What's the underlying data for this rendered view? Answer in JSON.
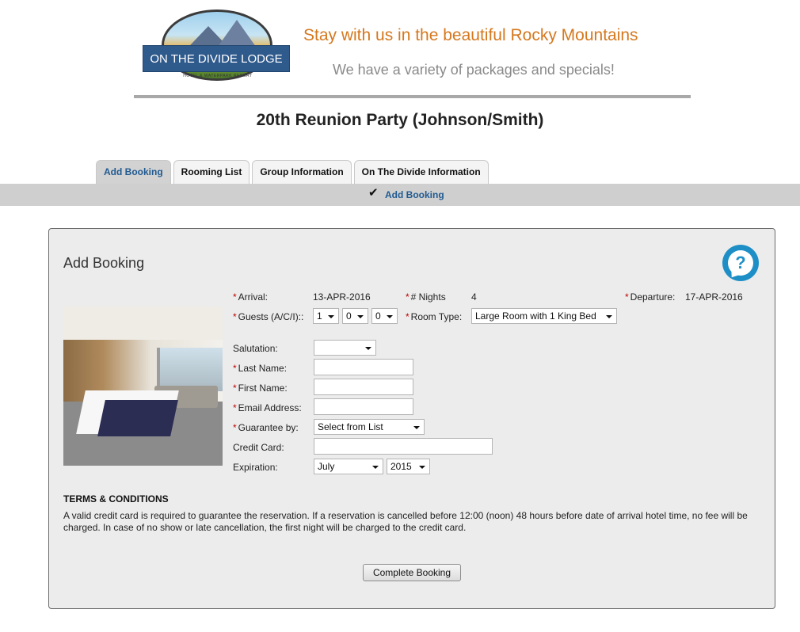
{
  "header": {
    "logo_text": "ON THE DIVIDE LODGE",
    "logo_subtext": "HOTEL & WATERPARK RESORT",
    "tagline": "Stay with us in the beautiful Rocky Mountains",
    "subline": "We have a variety of packages and specials!"
  },
  "page_title": "20th Reunion Party (Johnson/Smith)",
  "tabs": [
    {
      "label": "Add Booking",
      "active": true
    },
    {
      "label": "Rooming List",
      "active": false
    },
    {
      "label": "Group Information",
      "active": false
    },
    {
      "label": "On The Divide Information",
      "active": false
    }
  ],
  "subnav": {
    "check": "✔",
    "link": "Add Booking"
  },
  "panel": {
    "title": "Add Booking",
    "help_icon": "?",
    "arrival_label": "Arrival:",
    "arrival_value": "13-APR-2016",
    "nights_label": "# Nights",
    "nights_value": "4",
    "departure_label": "Departure:",
    "departure_value": "17-APR-2016",
    "guests_label": "Guests (A/C/I)::",
    "guests_adults": "1",
    "guests_children": "0",
    "guests_infants": "0",
    "room_type_label": "Room Type:",
    "room_type_value": "Large Room with 1 King Bed",
    "salutation_label": "Salutation:",
    "salutation_value": "",
    "last_name_label": "Last Name:",
    "first_name_label": "First Name:",
    "email_label": "Email Address:",
    "guarantee_label": "Guarantee by:",
    "guarantee_value": "Select from List",
    "credit_card_label": "Credit Card:",
    "expiration_label": "Expiration:",
    "exp_month": "July",
    "exp_year": "2015",
    "required_marker": "*"
  },
  "terms": {
    "title": "TERMS & CONDITIONS",
    "text": "A valid credit card is required to guarantee the reservation. If a reservation is cancelled before 12:00 (noon) 48 hours before date of arrival hotel time, no fee will be charged. In case of no show or late cancellation, the first night will be charged to the credit card."
  },
  "submit_label": "Complete Booking",
  "colors": {
    "tagline": "#d5781e",
    "active_tab_text": "#215a91",
    "required": "#c00000",
    "help_icon": "#1e8fc6",
    "logo_banner": "#2f5a8c"
  }
}
